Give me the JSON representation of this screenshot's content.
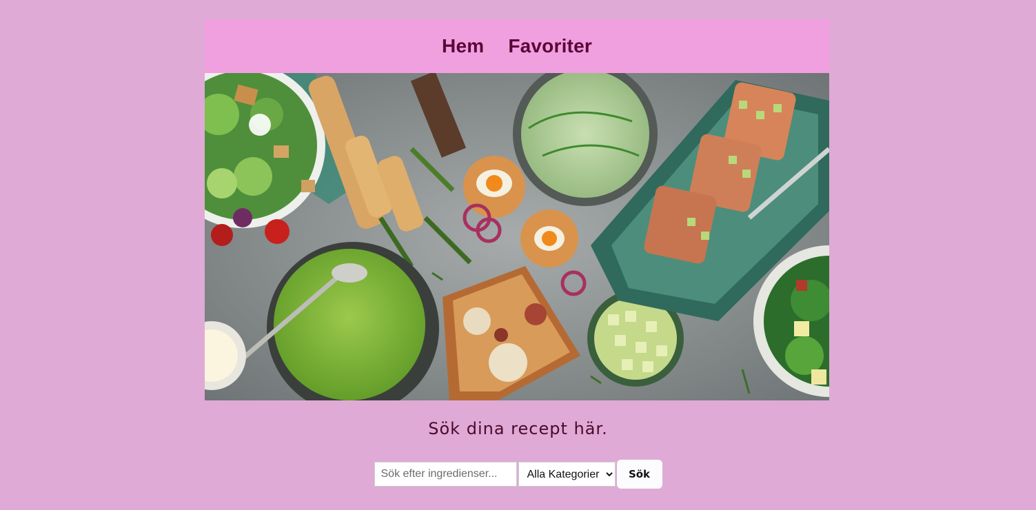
{
  "nav": {
    "links": [
      {
        "label": "Hem"
      },
      {
        "label": "Favoriter"
      }
    ]
  },
  "main": {
    "tagline": "Sök dina recept här.",
    "search": {
      "placeholder": "Sök efter ingredienser...",
      "value": ""
    },
    "category": {
      "selected": "Alla Kategorier"
    },
    "submit_label": "Sök"
  },
  "colors": {
    "page_background": "#dfaad5",
    "navbar_background": "#f09fdf",
    "nav_text": "#5a0637",
    "tagline_text": "#4a0a2c"
  }
}
